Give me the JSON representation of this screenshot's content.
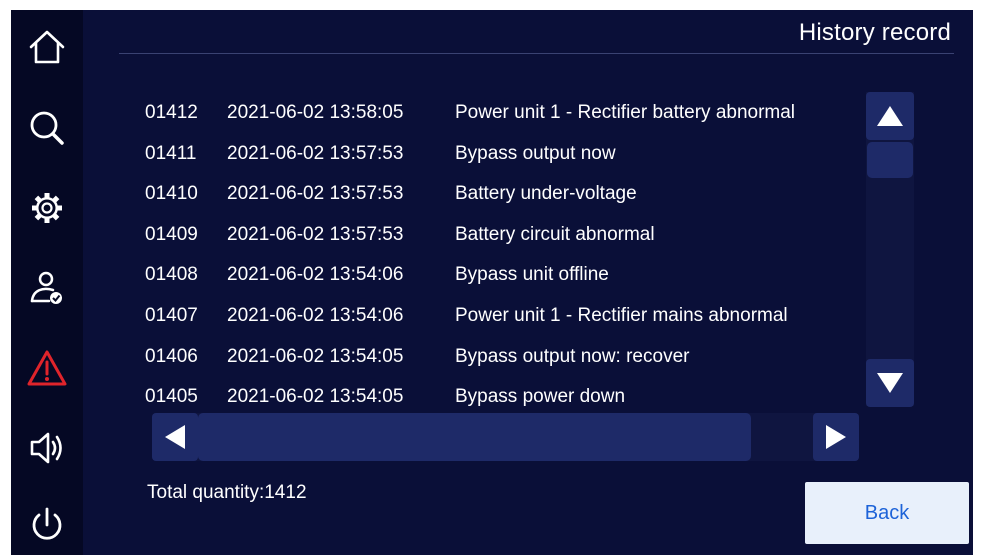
{
  "header": {
    "title": "History record"
  },
  "sidebar": {
    "items": [
      {
        "name": "home",
        "icon": "home-icon"
      },
      {
        "name": "search",
        "icon": "search-icon"
      },
      {
        "name": "settings",
        "icon": "gear-icon"
      },
      {
        "name": "user",
        "icon": "user-check-icon"
      },
      {
        "name": "alarm",
        "icon": "warning-icon",
        "color": "#e0242b"
      },
      {
        "name": "sound",
        "icon": "speaker-icon"
      },
      {
        "name": "power",
        "icon": "power-icon"
      }
    ]
  },
  "records": [
    {
      "no": "01412",
      "time": "2021-06-02 13:58:05",
      "event": "Power unit 1 - Rectifier battery abnormal"
    },
    {
      "no": "01411",
      "time": "2021-06-02 13:57:53",
      "event": "Bypass output now"
    },
    {
      "no": "01410",
      "time": "2021-06-02 13:57:53",
      "event": "Battery under-voltage"
    },
    {
      "no": "01409",
      "time": "2021-06-02 13:57:53",
      "event": "Battery circuit abnormal"
    },
    {
      "no": "01408",
      "time": "2021-06-02 13:54:06",
      "event": "Bypass unit offline"
    },
    {
      "no": "01407",
      "time": "2021-06-02 13:54:06",
      "event": "Power unit 1 - Rectifier mains abnormal"
    },
    {
      "no": "01406",
      "time": "2021-06-02 13:54:05",
      "event": "Bypass output now: recover"
    },
    {
      "no": "01405",
      "time": "2021-06-02 13:54:05",
      "event": "Bypass power down"
    }
  ],
  "footer": {
    "total_text": "Total quantity:1412",
    "back_label": "Back"
  },
  "colors": {
    "background": "#0a0f38",
    "sidebar": "#050824",
    "scroll": "#1e2a68",
    "alarm": "#e0242b",
    "button_text": "#1d63d8"
  }
}
